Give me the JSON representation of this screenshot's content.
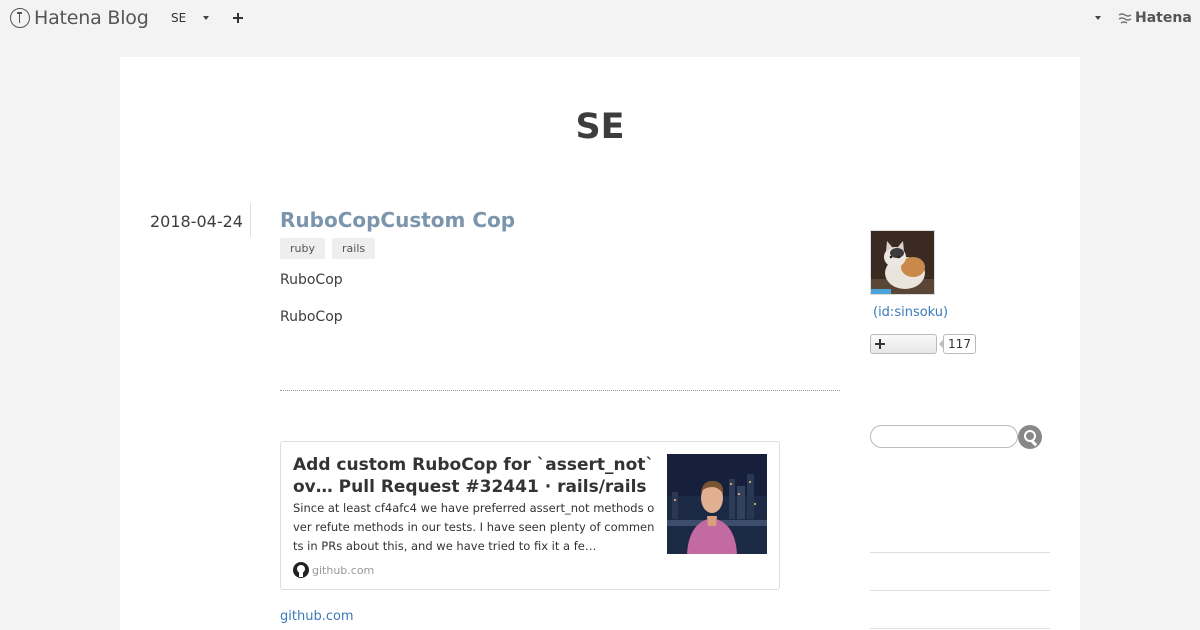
{
  "global_header": {
    "logo_text": "Hatena Blog",
    "blog_switcher_label": "SE",
    "new_post_icon": "plus-icon",
    "account_menu_icon": "caret-down-icon",
    "brand_text": "Hatena"
  },
  "blog": {
    "title": "SE"
  },
  "entry": {
    "date": "2018-04-24",
    "title": "RuboCopCustom Cop",
    "categories": [
      "ruby",
      "rails"
    ],
    "paragraphs": [
      "RuboCop",
      "RuboCop"
    ],
    "link_card": {
      "title": "Add custom RuboCop for `assert_not` ov… Pull Request #32441 · rails/rails",
      "description": "Since at least cf4afc4 we have preferred assert_not methods over refute methods in our tests. I have seen plenty of comments in PRs about this, and we have tried to fix it a fe…",
      "domain": "github.com",
      "domain_icon": "github-icon"
    },
    "source_link": "github.com"
  },
  "sidebar": {
    "profile_id": "(id:sinsoku)",
    "subscriber_count": "117",
    "subscribe_icon": "plus-icon",
    "search_icon": "search-icon"
  },
  "colors": {
    "page_background": "#f3f3f3",
    "card_background": "#ffffff",
    "entry_title": "#7b95ad",
    "link": "#3a7bb8",
    "text": "#3d3d3d"
  }
}
